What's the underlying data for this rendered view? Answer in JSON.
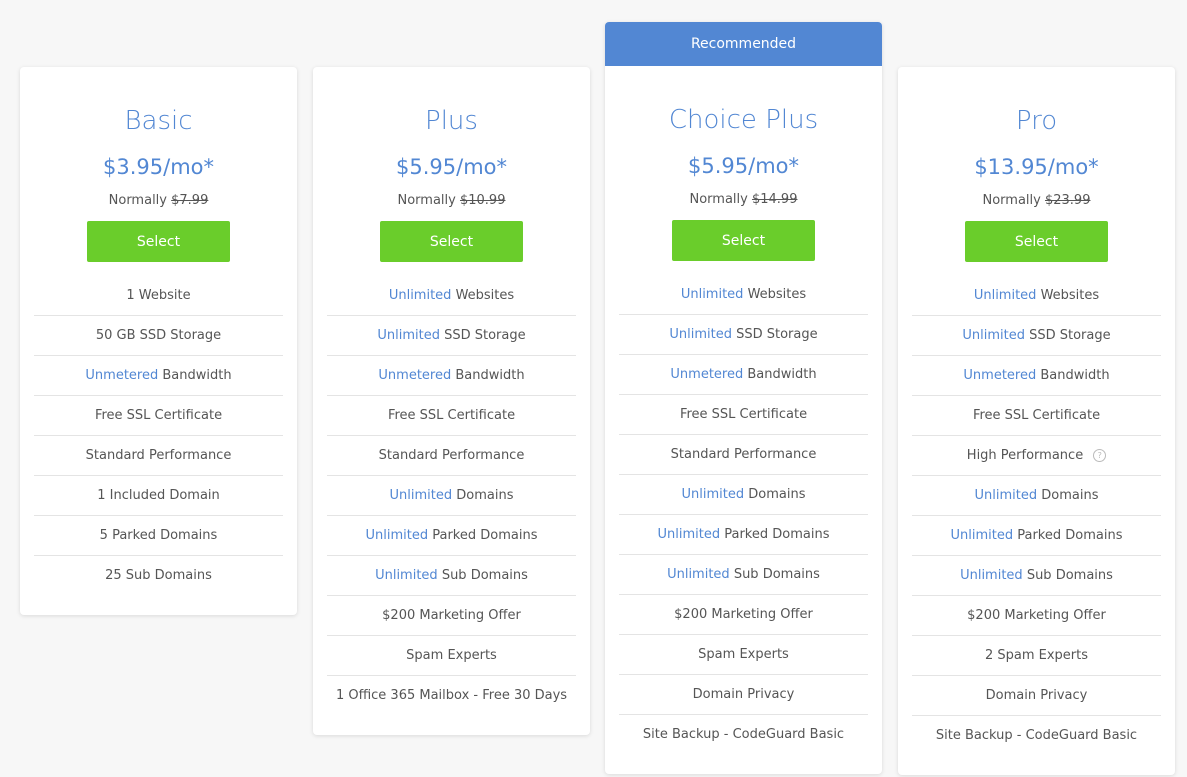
{
  "plans": [
    {
      "name": "Basic",
      "price": "$3.95/mo*",
      "normally_label": "Normally",
      "normal_price": "$7.99",
      "select_label": "Select",
      "features": [
        {
          "hl": "",
          "text": "1 Website"
        },
        {
          "hl": "",
          "text": "50 GB SSD Storage"
        },
        {
          "hl": "Unmetered",
          "text": " Bandwidth"
        },
        {
          "hl": "",
          "text": "Free SSL Certificate"
        },
        {
          "hl": "",
          "text": "Standard Performance"
        },
        {
          "hl": "",
          "text": "1 Included Domain"
        },
        {
          "hl": "",
          "text": "5 Parked Domains"
        },
        {
          "hl": "",
          "text": "25 Sub Domains"
        }
      ]
    },
    {
      "name": "Plus",
      "price": "$5.95/mo*",
      "normally_label": "Normally",
      "normal_price": "$10.99",
      "select_label": "Select",
      "features": [
        {
          "hl": "Unlimited",
          "text": " Websites"
        },
        {
          "hl": "Unlimited",
          "text": " SSD Storage"
        },
        {
          "hl": "Unmetered",
          "text": " Bandwidth"
        },
        {
          "hl": "",
          "text": "Free SSL Certificate"
        },
        {
          "hl": "",
          "text": "Standard Performance"
        },
        {
          "hl": "Unlimited",
          "text": " Domains"
        },
        {
          "hl": "Unlimited",
          "text": " Parked Domains"
        },
        {
          "hl": "Unlimited",
          "text": " Sub Domains"
        },
        {
          "hl": "",
          "text": "$200 Marketing Offer"
        },
        {
          "hl": "",
          "text": "Spam Experts"
        },
        {
          "hl": "",
          "text": "1 Office 365 Mailbox - Free 30 Days",
          "link": true
        }
      ]
    },
    {
      "name": "Choice Plus",
      "recommended": "Recommended",
      "price": "$5.95/mo*",
      "normally_label": "Normally",
      "normal_price": "$14.99",
      "select_label": "Select",
      "features": [
        {
          "hl": "Unlimited",
          "text": " Websites"
        },
        {
          "hl": "Unlimited",
          "text": " SSD Storage"
        },
        {
          "hl": "Unmetered",
          "text": " Bandwidth"
        },
        {
          "hl": "",
          "text": "Free SSL Certificate"
        },
        {
          "hl": "",
          "text": "Standard Performance"
        },
        {
          "hl": "Unlimited",
          "text": " Domains"
        },
        {
          "hl": "Unlimited",
          "text": " Parked Domains"
        },
        {
          "hl": "Unlimited",
          "text": " Sub Domains"
        },
        {
          "hl": "",
          "text": "$200 Marketing Offer"
        },
        {
          "hl": "",
          "text": "Spam Experts"
        },
        {
          "hl": "",
          "text": "Domain Privacy"
        },
        {
          "hl": "",
          "text": "Site Backup - CodeGuard Basic"
        }
      ]
    },
    {
      "name": "Pro",
      "price": "$13.95/mo*",
      "normally_label": "Normally",
      "normal_price": "$23.99",
      "select_label": "Select",
      "features": [
        {
          "hl": "Unlimited",
          "text": " Websites"
        },
        {
          "hl": "Unlimited",
          "text": " SSD Storage"
        },
        {
          "hl": "Unmetered",
          "text": " Bandwidth"
        },
        {
          "hl": "",
          "text": "Free SSL Certificate"
        },
        {
          "hl": "",
          "text": "High Performance",
          "help": "?"
        },
        {
          "hl": "Unlimited",
          "text": " Domains"
        },
        {
          "hl": "Unlimited",
          "text": " Parked Domains"
        },
        {
          "hl": "Unlimited",
          "text": " Sub Domains"
        },
        {
          "hl": "",
          "text": "$200 Marketing Offer"
        },
        {
          "hl": "",
          "text": "2 Spam Experts"
        },
        {
          "hl": "",
          "text": "Domain Privacy"
        },
        {
          "hl": "",
          "text": "Site Backup - CodeGuard Basic"
        }
      ]
    }
  ]
}
